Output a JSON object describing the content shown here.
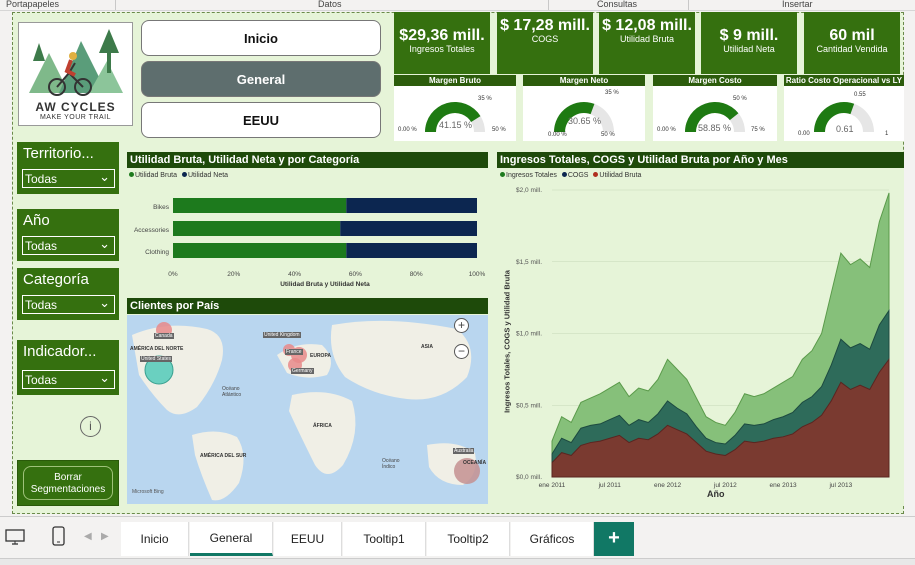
{
  "ribbon": {
    "groups": [
      "Portapapeles",
      "Datos",
      "Consultas",
      "Insertar"
    ]
  },
  "logo": {
    "brand": "AW CYCLES",
    "tagline": "MAKE YOUR TRAIL"
  },
  "nav": {
    "inicio": "Inicio",
    "general": "General",
    "eeuu": "EEUU"
  },
  "kpis": [
    {
      "value": "$29,36 mill.",
      "label": "Ingresos Totales"
    },
    {
      "value": "$ 17,28 mill.",
      "label": "COGS"
    },
    {
      "value": "$ 12,08 mill.",
      "label": "Utilidad Bruta"
    },
    {
      "value": "$ 9 mill.",
      "label": "Utilidad Neta"
    },
    {
      "value": "60 mil",
      "label": "Cantidad Vendida"
    }
  ],
  "gauges": [
    {
      "title": "Margen Bruto",
      "value": "41.15 %",
      "min": "0.00 %",
      "max": "50 %",
      "target": "35 %",
      "fraction": 0.823
    },
    {
      "title": "Margen Neto",
      "value": "30.65 %",
      "min": "0.00 %",
      "max": "50 %",
      "target": "35 %",
      "fraction": 0.613
    },
    {
      "title": "Margen Costo",
      "value": "58.85 %",
      "min": "0.00 %",
      "max": "75 %",
      "target": "50 %",
      "fraction": 0.785
    },
    {
      "title": "Ratio Costo Operacional vs LY",
      "value": "0.61",
      "min": "0.00",
      "max": "1",
      "target": "0.55",
      "fraction": 0.61
    }
  ],
  "slicers": [
    {
      "title": "Territorio...",
      "value": "Todas"
    },
    {
      "title": "Año",
      "value": "Todas"
    },
    {
      "title": "Categoría",
      "value": "Todas"
    },
    {
      "title": "Indicador...",
      "value": "Todas"
    }
  ],
  "info_icon": "i",
  "clear_button": "Borrar Segmentaciones",
  "bar_panel": {
    "title": "Utilidad Bruta, Utilidad Neta y por Categoría",
    "legend": [
      "Utilidad Bruta",
      "Utilidad Neta"
    ],
    "xlabel": "Utilidad Bruta y Utilidad Neta",
    "ticks": [
      "0%",
      "20%",
      "40%",
      "60%",
      "80%",
      "100%"
    ]
  },
  "map_panel": {
    "title": "Clientes por País",
    "labels": [
      "Canada",
      "AMÉRICA DEL NORTE",
      "United States",
      "United Kingdom",
      "France",
      "Germany",
      "EUROPA",
      "ASIA",
      "Océano Atlántico",
      "ÁFRICA",
      "AMÉRICA DEL SUR",
      "Australia",
      "OCEANÍA",
      "Océano Índico"
    ],
    "zoom_in": "+",
    "zoom_out": "−",
    "attribution": "Microsoft Bing"
  },
  "area_panel": {
    "title": "Ingresos Totales, COGS y Utilidad Bruta por Año y Mes",
    "legend": [
      "Ingresos Totales",
      "COGS",
      "Utilidad Bruta"
    ],
    "ylabel": "Ingresos Totales, COGS y Utilidad Bruta",
    "xlabel": "Año"
  },
  "tabs": [
    "Inicio",
    "General",
    "EEUU",
    "Tooltip1",
    "Tooltip2",
    "Gráficos"
  ],
  "add_tab": "+",
  "colors": {
    "dark_green": "#35700f",
    "header_green": "#1e4a0a",
    "navy": "#0c2650",
    "light_green": "#86c07a",
    "teal": "#2e6b5a",
    "brown": "#7a3a30",
    "accent": "#117865"
  },
  "chart_data": [
    {
      "type": "bar",
      "stacked": "100%",
      "categories": [
        "Bikes",
        "Accessories",
        "Clothing"
      ],
      "series": [
        {
          "name": "Utilidad Bruta",
          "values": [
            57,
            55,
            57
          ]
        },
        {
          "name": "Utilidad Neta",
          "values": [
            43,
            45,
            43
          ]
        }
      ],
      "title": "Utilidad Bruta, Utilidad Neta y por Categoría",
      "xlabel": "Utilidad Bruta y Utilidad Neta",
      "xlim": [
        0,
        100
      ]
    },
    {
      "type": "area",
      "title": "Ingresos Totales, COGS y Utilidad Bruta por Año y Mes",
      "xlabel": "Año",
      "ylabel": "Ingresos Totales, COGS y Utilidad Bruta",
      "x": [
        "2011-01",
        "2011-02",
        "2011-03",
        "2011-04",
        "2011-05",
        "2011-06",
        "2011-07",
        "2011-08",
        "2011-09",
        "2011-10",
        "2011-11",
        "2011-12",
        "2012-01",
        "2012-02",
        "2012-03",
        "2012-04",
        "2012-05",
        "2012-06",
        "2012-07",
        "2012-08",
        "2012-09",
        "2012-10",
        "2012-11",
        "2012-12",
        "2013-01",
        "2013-02",
        "2013-03",
        "2013-04",
        "2013-05",
        "2013-06",
        "2013-07",
        "2013-08",
        "2013-09",
        "2013-10",
        "2013-11",
        "2013-12"
      ],
      "x_ticks": [
        "ene 2011",
        "jul 2011",
        "ene 2012",
        "jul 2012",
        "ene 2013",
        "jul 2013"
      ],
      "y_ticks": [
        "$0,0 mill.",
        "$0,5 mill.",
        "$1,0 mill.",
        "$1,5 mill.",
        "$2,0 mill."
      ],
      "ylim": [
        0,
        2.0
      ],
      "y_unit": "mill.",
      "series": [
        {
          "name": "Ingresos Totales",
          "values": [
            0.25,
            0.42,
            0.38,
            0.52,
            0.55,
            0.58,
            0.62,
            0.66,
            0.56,
            0.62,
            0.6,
            0.68,
            0.82,
            0.75,
            0.68,
            0.55,
            0.42,
            0.38,
            0.36,
            0.45,
            0.58,
            0.56,
            0.58,
            0.62,
            0.66,
            0.7,
            0.82,
            0.88,
            1.0,
            1.28,
            1.56,
            1.48,
            1.52,
            1.46,
            1.78,
            1.98
          ]
        },
        {
          "name": "COGS",
          "values": [
            0.16,
            0.27,
            0.24,
            0.34,
            0.36,
            0.37,
            0.4,
            0.43,
            0.36,
            0.4,
            0.38,
            0.44,
            0.53,
            0.48,
            0.44,
            0.35,
            0.27,
            0.24,
            0.23,
            0.29,
            0.37,
            0.36,
            0.37,
            0.4,
            0.42,
            0.45,
            0.52,
            0.56,
            0.63,
            0.78,
            0.96,
            0.9,
            0.93,
            0.89,
            1.06,
            1.16
          ]
        },
        {
          "name": "Utilidad Bruta",
          "values": [
            0.1,
            0.17,
            0.15,
            0.22,
            0.24,
            0.25,
            0.27,
            0.29,
            0.24,
            0.27,
            0.26,
            0.3,
            0.36,
            0.33,
            0.3,
            0.24,
            0.18,
            0.16,
            0.15,
            0.19,
            0.25,
            0.24,
            0.25,
            0.27,
            0.28,
            0.3,
            0.35,
            0.38,
            0.43,
            0.53,
            0.66,
            0.61,
            0.64,
            0.61,
            0.73,
            0.82
          ]
        }
      ]
    }
  ]
}
